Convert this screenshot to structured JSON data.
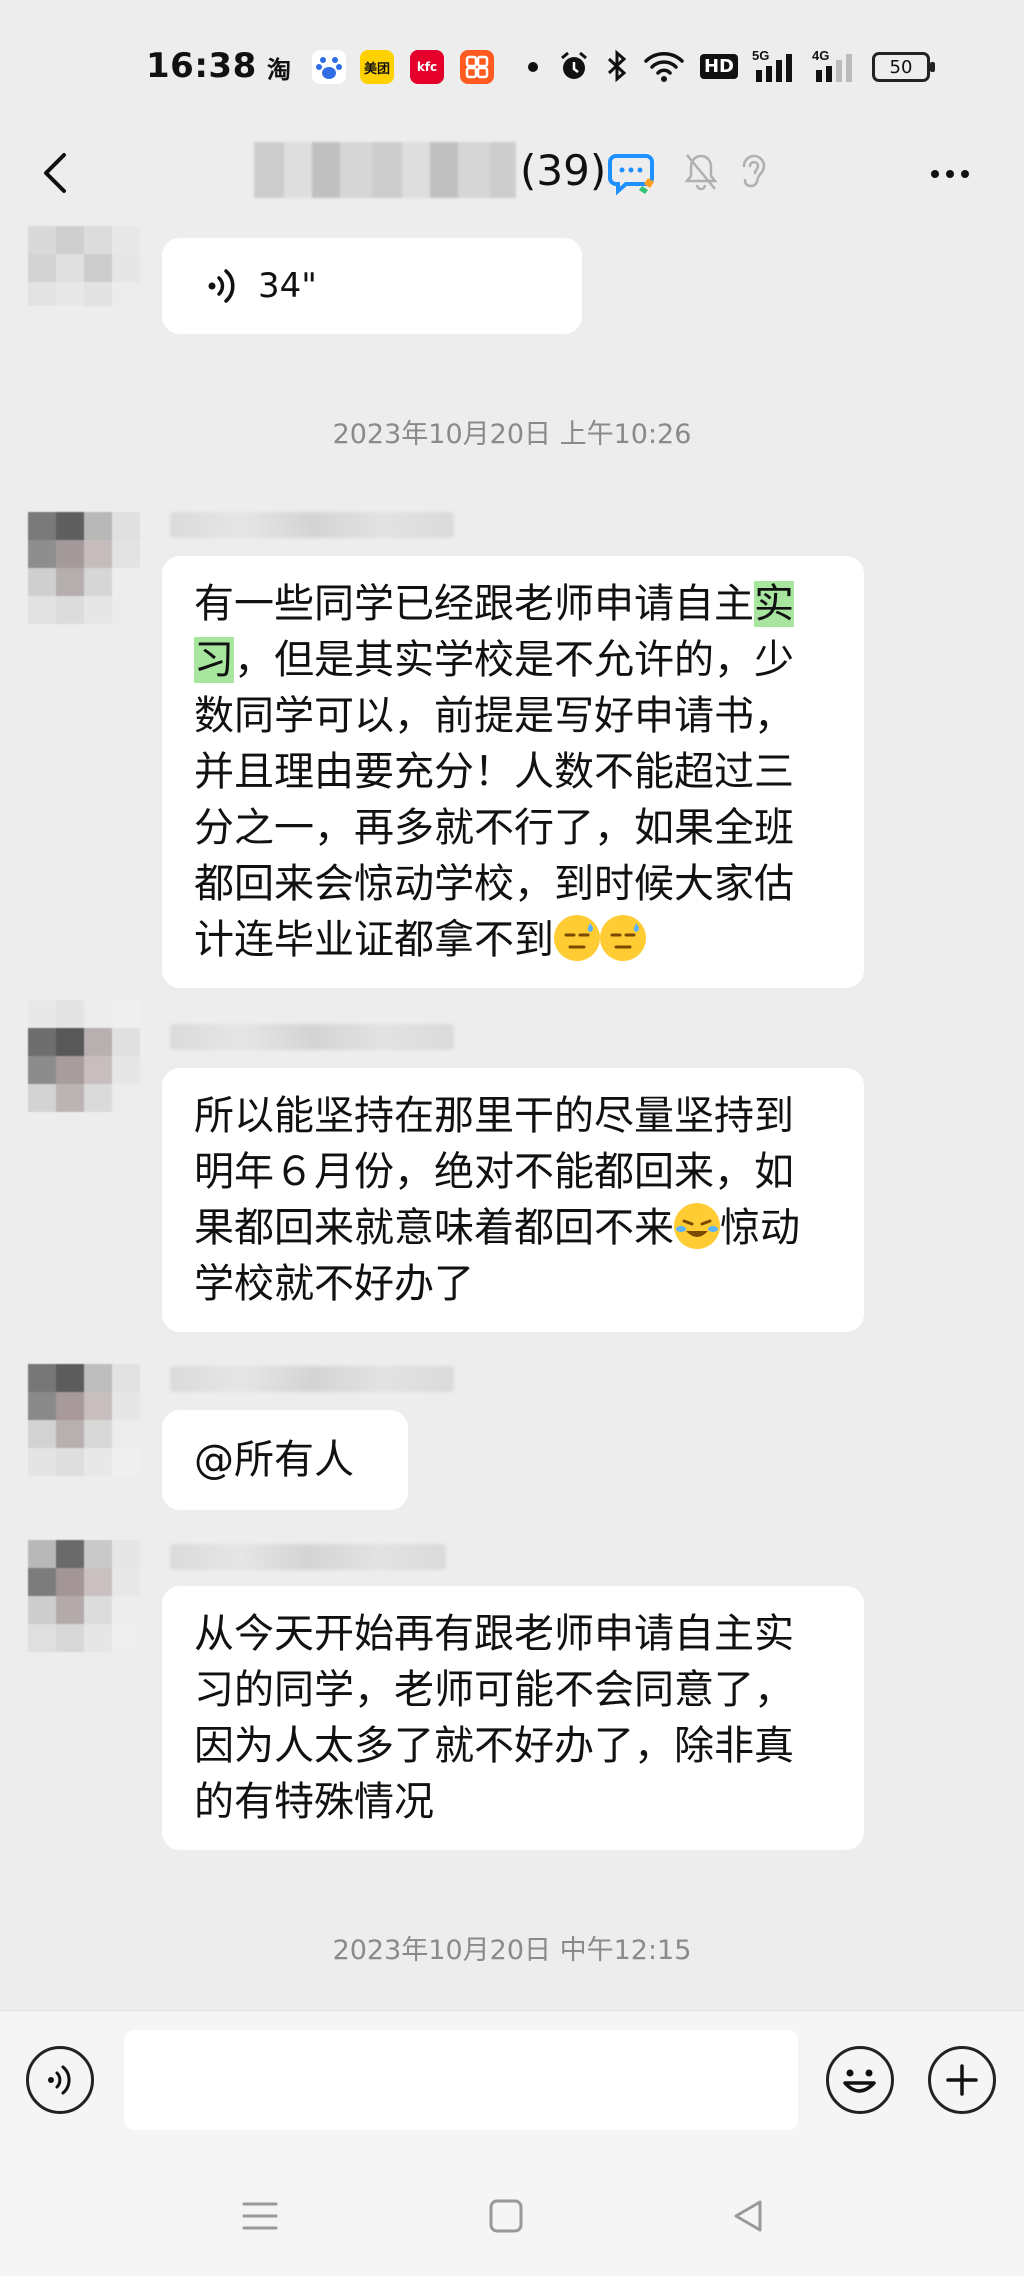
{
  "status_bar": {
    "time": "16:38",
    "apps": [
      {
        "name": "taobao-icon",
        "label": "淘",
        "color": "#ffffff"
      },
      {
        "name": "baidu-icon",
        "label": "",
        "color": "#ffffff"
      },
      {
        "name": "meituan-icon",
        "label": "美团",
        "color": "#ffd100"
      },
      {
        "name": "kfc-icon",
        "label": "kfc",
        "color": "#e4002b"
      },
      {
        "name": "app-grid-icon",
        "label": "",
        "color": "#ff5a1f"
      }
    ],
    "network_5g": "5G",
    "network_4g": "4G",
    "hd_label": "HD",
    "battery": "50"
  },
  "header": {
    "back_icon": "chevron-left-icon",
    "title_count": "(39)",
    "more_icon": "more-dots-icon"
  },
  "messages": [
    {
      "kind": "voice",
      "duration": "34\""
    },
    {
      "kind": "timestamp",
      "text": "2023年10月20日 上午10:26"
    },
    {
      "kind": "text",
      "pre": "有一些同学已经跟老师申请自主",
      "highlight1": "实",
      "highlight2": "习",
      "post": "，但是其实学校是不允许的，少数同学可以，前提是写好申请书，并且理由要充分！人数不能超过三分之一，再多就不行了，如果全班都回来会惊动学校，到时候大家估计连毕业证都拿不到"
    },
    {
      "kind": "text",
      "pre": "所以能坚持在那里干的尽量坚持到明年６月份，绝对不能都回来，如果都回来就意味着都回不来",
      "post": "惊动学校就不好办了"
    },
    {
      "kind": "text",
      "text": "@所有人"
    },
    {
      "kind": "text",
      "text": "从今天开始再有跟老师申请自主实习的同学，老师可能不会同意了，因为人太多了就不好办了，除非真的有特殊情况"
    },
    {
      "kind": "timestamp",
      "text": "2023年10月20日 中午12:15"
    }
  ],
  "input": {
    "placeholder": "",
    "value": ""
  },
  "colors": {
    "background": "#ededed",
    "bubble": "#ffffff",
    "highlight": "#a8e6a0",
    "timestamp": "#8a8a8a"
  }
}
